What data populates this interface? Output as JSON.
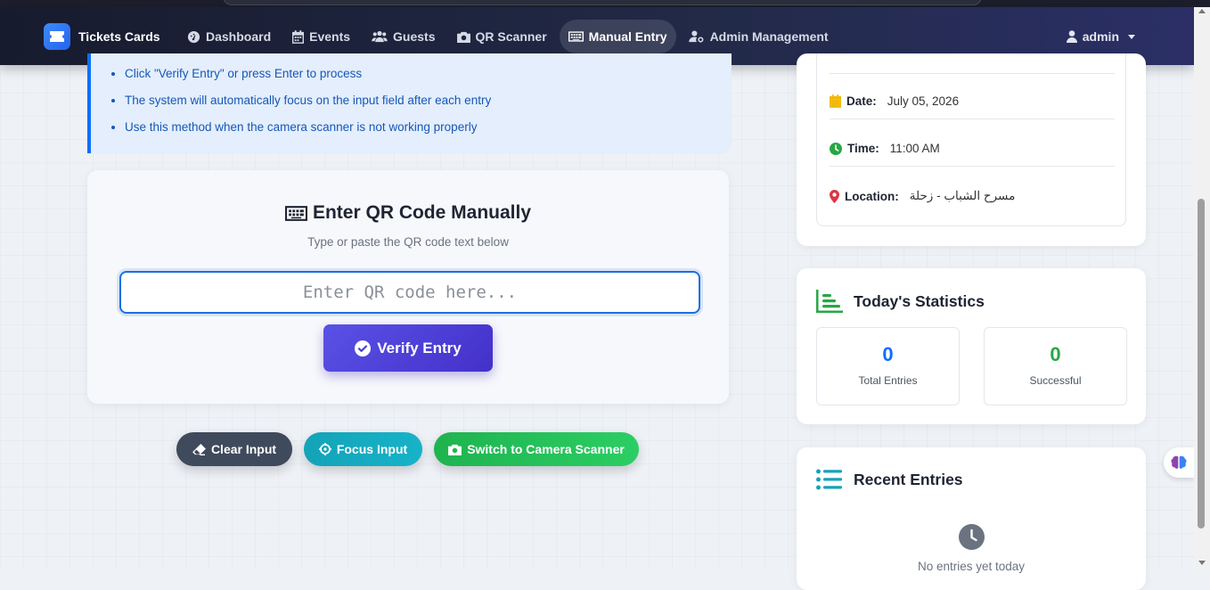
{
  "nav": {
    "brand": "Tickets Cards",
    "items": [
      {
        "label": "Dashboard",
        "icon": "gauge-icon"
      },
      {
        "label": "Events",
        "icon": "calendar-icon"
      },
      {
        "label": "Guests",
        "icon": "users-icon"
      },
      {
        "label": "QR Scanner",
        "icon": "camera-icon"
      },
      {
        "label": "Manual Entry",
        "icon": "keyboard-icon",
        "active": true
      },
      {
        "label": "Admin Management",
        "icon": "user-gear-icon"
      }
    ],
    "user": "admin"
  },
  "instructions": {
    "items": [
      "Click \"Verify Entry\" or press Enter to process",
      "The system will automatically focus on the input field after each entry",
      "Use this method when the camera scanner is not working properly"
    ]
  },
  "manual": {
    "title": "Enter QR Code Manually",
    "subtitle": "Type or paste the QR code text below",
    "placeholder": "Enter QR code here...",
    "verify_label": "Verify Entry"
  },
  "actions": {
    "clear": "Clear Input",
    "focus": "Focus Input",
    "camera": "Switch to Camera Scanner"
  },
  "event": {
    "date_label": "Date:",
    "date_value": "July 05, 2026",
    "time_label": "Time:",
    "time_value": "11:00 AM",
    "location_label": "Location:",
    "location_value": "مسرح الشباب - زحلة"
  },
  "stats": {
    "title": "Today's Statistics",
    "total_value": "0",
    "total_label": "Total Entries",
    "success_value": "0",
    "success_label": "Successful"
  },
  "recent": {
    "title": "Recent Entries",
    "empty": "No entries yet today"
  },
  "colors": {
    "primary": "#0d6efd",
    "success": "#28a745",
    "accent": "#4f46e5"
  }
}
